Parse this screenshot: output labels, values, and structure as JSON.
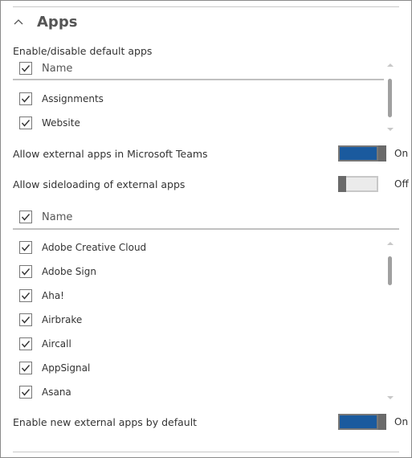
{
  "section": {
    "title": "Apps"
  },
  "default_apps": {
    "label": "Enable/disable default apps",
    "column_header": "Name",
    "items": [
      "Assignments",
      "Website"
    ]
  },
  "allow_external": {
    "label": "Allow external apps in Microsoft Teams",
    "state": "On"
  },
  "allow_sideloading": {
    "label": "Allow sideloading of external apps",
    "state": "Off"
  },
  "external_apps": {
    "column_header": "Name",
    "items": [
      "Adobe Creative Cloud",
      "Adobe Sign",
      "Aha!",
      "Airbrake",
      "Aircall",
      "AppSignal",
      "Asana"
    ]
  },
  "enable_new": {
    "label": "Enable new external apps by default",
    "state": "On"
  },
  "colors": {
    "toggle_on": "#1a5a9e",
    "toggle_off": "#ebebeb",
    "knob": "#6a6a6a",
    "title": "#555555"
  }
}
